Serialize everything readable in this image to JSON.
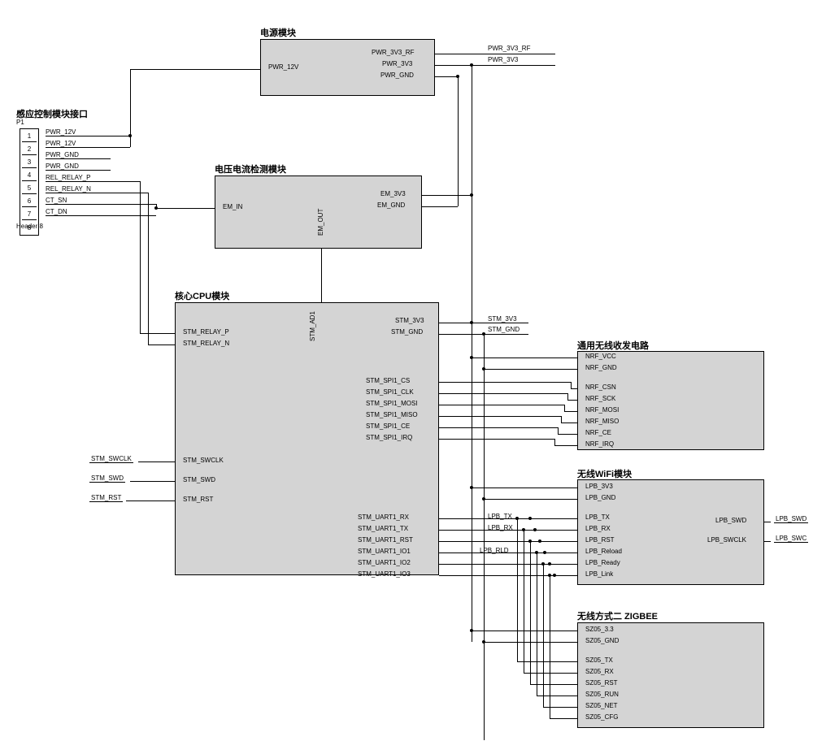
{
  "header": {
    "title": "感应控制模块接口",
    "ref": "P1",
    "footer": "Header 8",
    "pins": [
      "1",
      "2",
      "3",
      "4",
      "5",
      "6",
      "7",
      "8"
    ],
    "nets": [
      "PWR_12V",
      "PWR_12V",
      "PWR_GND",
      "PWR_GND",
      "REL_RELAY_P",
      "REL_RELAY_N",
      "CT_SN",
      "CT_DN"
    ]
  },
  "power": {
    "title": "电源模块",
    "left": [
      "PWR_12V"
    ],
    "right": [
      "PWR_3V3_RF",
      "PWR_3V3",
      "PWR_GND"
    ]
  },
  "em": {
    "title": "电压电流检测模块",
    "left": [
      "EM_IN"
    ],
    "right": [
      "EM_3V3",
      "EM_GND"
    ],
    "top": "EM_OUT"
  },
  "cpu": {
    "title": "核心CPU模块",
    "top": "STM_AD1",
    "left_upper": [
      "STM_RELAY_P",
      "STM_RELAY_N"
    ],
    "left_lower": [
      "STM_SWCLK",
      "STM_SWD",
      "STM_RST"
    ],
    "right_top": [
      "STM_3V3",
      "STM_GND"
    ],
    "right_spi": [
      "STM_SPI1_CS",
      "STM_SPI1_CLK",
      "STM_SPI1_MOSI",
      "STM_SPI1_MISO",
      "STM_SPI1_CE",
      "STM_SPI1_IRQ"
    ],
    "right_uart": [
      "STM_UART1_RX",
      "STM_UART1_TX",
      "STM_UART1_RST",
      "STM_UART1_IO1",
      "STM_UART1_IO2",
      "STM_UART1_IO3"
    ]
  },
  "nrf": {
    "title": "通用无线收发电路",
    "pins": [
      "NRF_VCC",
      "NRF_GND",
      "NRF_CSN",
      "NRF_SCK",
      "NRF_MOSI",
      "NRF_MISO",
      "NRF_CE",
      "NRF_IRQ"
    ]
  },
  "wifi": {
    "title": "无线WiFi模块",
    "left": [
      "LPB_3V3",
      "LPB_GND",
      "LPB_TX",
      "LPB_RX",
      "LPB_RST",
      "LPB_Reload",
      "LPB_Ready",
      "LPB_Link"
    ],
    "right": [
      "LPB_SWD",
      "LPB_SWCLK"
    ]
  },
  "zigbee": {
    "title": "无线方式二 ZIGBEE",
    "pins": [
      "SZ05_3.3",
      "SZ05_GND",
      "SZ05_TX",
      "SZ05_RX",
      "SZ05_RST",
      "SZ05_RUN",
      "SZ05_NET",
      "SZ05_CFG"
    ]
  },
  "nets": {
    "pwr_3v3_rf": "PWR_3V3_RF",
    "pwr_3v3": "PWR_3V3",
    "stm_3v3": "STM_3V3",
    "stm_gnd": "STM_GND",
    "lpb_tx": "LPB_TX",
    "lpb_rx": "LPB_RX",
    "lpb_rld": "LPB_RLD",
    "lpb_swd": "LPB_SWD",
    "lpb_swc": "LPB_SWC",
    "stm_swclk": "STM_SWCLK",
    "stm_swd": "STM_SWD",
    "stm_rst": "STM_RST"
  }
}
